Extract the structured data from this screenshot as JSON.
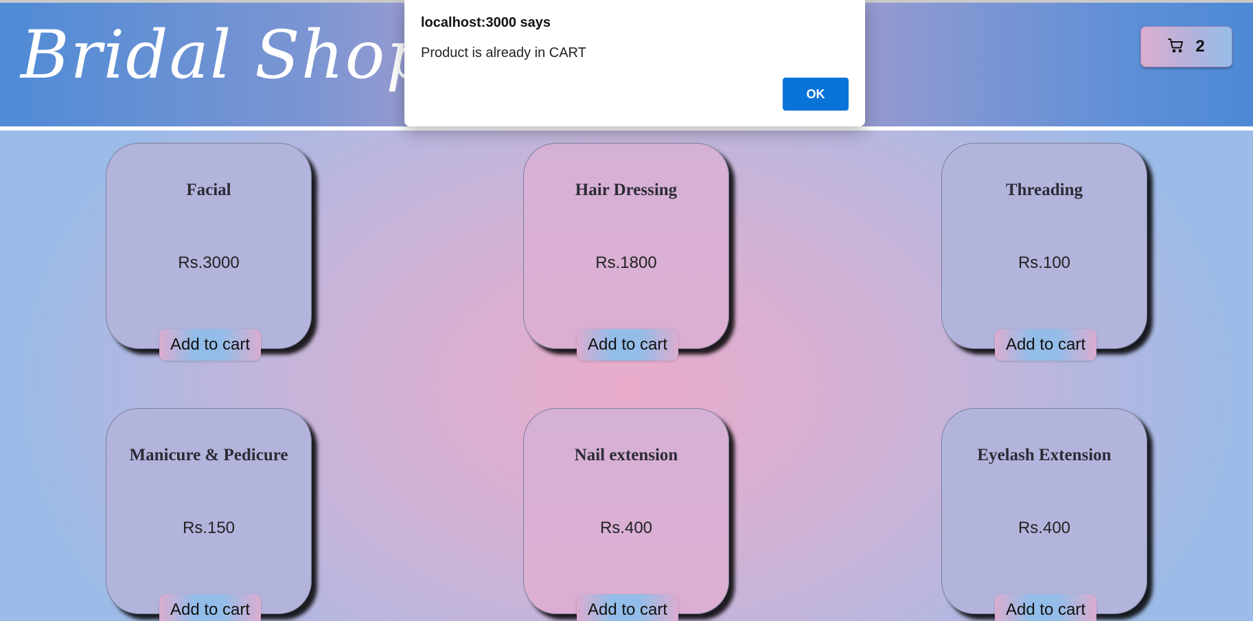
{
  "header": {
    "brand": "Bridal Shop",
    "cart_count": "2"
  },
  "products": [
    {
      "title": "Facial",
      "price": "Rs.3000",
      "button": "Add to cart"
    },
    {
      "title": "Hair Dressing",
      "price": "Rs.1800",
      "button": "Add to cart"
    },
    {
      "title": "Threading",
      "price": "Rs.100",
      "button": "Add to cart"
    },
    {
      "title": "Manicure & Pedicure",
      "price": "Rs.150",
      "button": "Add to cart"
    },
    {
      "title": "Nail extension",
      "price": "Rs.400",
      "button": "Add to cart"
    },
    {
      "title": "Eyelash Extension",
      "price": "Rs.400",
      "button": "Add to cart"
    }
  ],
  "dialog": {
    "title": "localhost:3000 says",
    "message": "Product is already in CART",
    "ok_label": "OK"
  },
  "colors": {
    "header_gradient_left": "#4f8bd6",
    "header_gradient_mid": "#a89fcf",
    "page_center_pink": "#eaaccb",
    "page_edge_blue": "#9cbbe8",
    "dialog_ok": "#0a73d8"
  },
  "icons": {
    "cart": "shopping-cart-icon"
  }
}
